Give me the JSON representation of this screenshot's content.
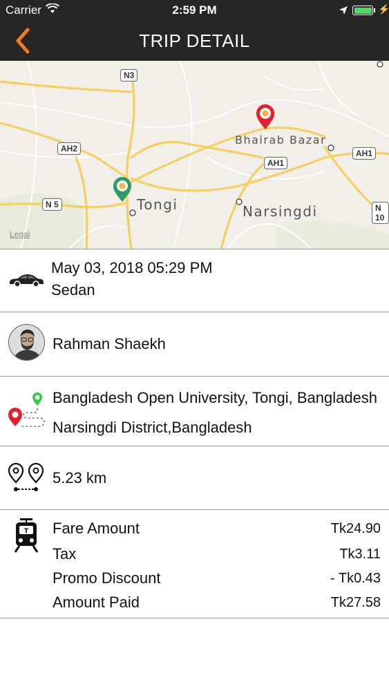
{
  "status_bar": {
    "carrier": "Carrier",
    "time": "2:59 PM",
    "icons": [
      "wifi-icon",
      "location-arrow-icon",
      "battery-icon",
      "charging-bolt-icon"
    ]
  },
  "nav": {
    "title": "TRIP DETAIL",
    "back_icon": "chevron-left-icon",
    "accent_color": "#f07c22"
  },
  "map": {
    "places": [
      "Bhairab Bazar",
      "Tongi",
      "Narsingdi"
    ],
    "road_badges": [
      "N3",
      "AH2",
      "N 5",
      "AH1",
      "AH1",
      "N 10"
    ],
    "legal_link": "Legal",
    "pickup_pin_color": "#2e9c6a",
    "dropoff_pin_color": "#e4202c"
  },
  "trip": {
    "datetime": "May 03, 2018 05:29 PM",
    "vehicle": "Sedan",
    "icon": "car-icon"
  },
  "driver": {
    "name": "Rahman Shaekh",
    "icon": "avatar"
  },
  "route": {
    "pickup": "Bangladesh Open University, Tongi, Bangladesh",
    "dropoff": "Narsingdi District,Bangladesh",
    "pickup_color": "#2ecc40",
    "dropoff_color": "#e4202c"
  },
  "distance": {
    "value": "5.23 km",
    "icon": "distance-pins-icon"
  },
  "fare": {
    "icon": "train-icon",
    "rows": [
      {
        "label": "Fare Amount",
        "amount": "Tk24.90"
      },
      {
        "label": "Tax",
        "amount": "Tk3.11"
      },
      {
        "label": "Promo Discount",
        "amount": "- Tk0.43"
      },
      {
        "label": "Amount Paid",
        "amount": "Tk27.58"
      }
    ]
  }
}
